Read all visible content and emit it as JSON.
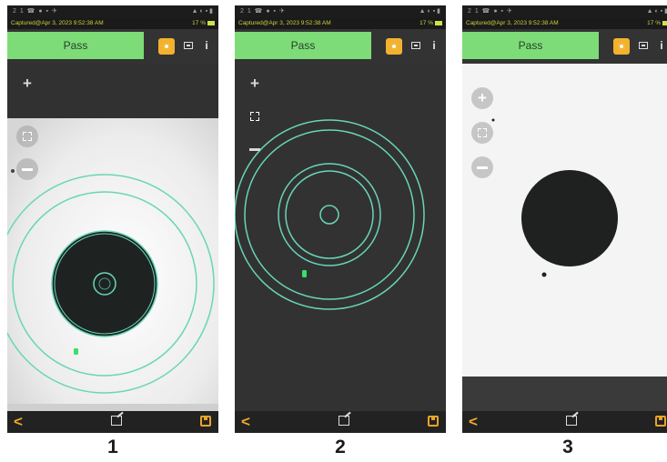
{
  "panels": [
    {
      "number": "1",
      "status_left": "2 1 ☎ ● ▪ ✈",
      "status_right": "▲ ◐ ▪ ▮",
      "capture_text": "Captured@Apr 3, 2023 9:52:38 AM",
      "battery": "17 %",
      "result": "Pass"
    },
    {
      "number": "2",
      "status_left": "2 1 ☎ ● ▪ ✈",
      "status_right": "▲ ◐ ▪ ▮",
      "capture_text": "Captured@Apr 3, 2023 9:52:38 AM",
      "battery": "17 %",
      "result": "Pass"
    },
    {
      "number": "3",
      "status_left": "2 1 ☎ ● ▪ ✈",
      "status_right": "▲ ◐ ▪ ▮",
      "capture_text": "Captured@Apr 3, 2023 9:52:38 AM",
      "battery": "17 %",
      "result": "Pass"
    }
  ],
  "controls": {
    "zoom_in": "+",
    "back": "<"
  },
  "colors": {
    "pass": "#7ddc77",
    "accent": "#f2b22e",
    "zone_ring": "#68d6b7",
    "defect": "#35e26a"
  },
  "icons": [
    "target-icon",
    "gallery-icon",
    "info-icon",
    "zoom-in-icon",
    "fit-screen-icon",
    "zoom-out-icon",
    "back-icon",
    "edit-icon",
    "save-icon"
  ]
}
